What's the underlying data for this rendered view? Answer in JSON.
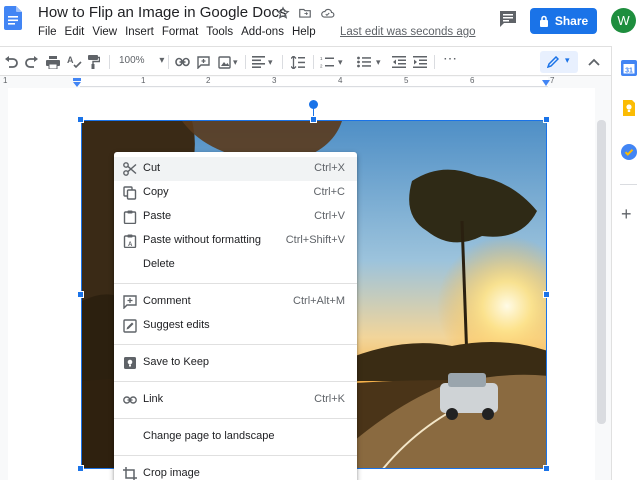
{
  "header": {
    "title": "How to Flip an Image in Google Docs",
    "menu": [
      "File",
      "Edit",
      "View",
      "Insert",
      "Format",
      "Tools",
      "Add-ons",
      "Help"
    ],
    "last_edit": "Last edit was seconds ago",
    "share_label": "Share",
    "avatar_letter": "W"
  },
  "toolbar": {
    "zoom": "100%"
  },
  "ruler": {
    "numbers": [
      "1",
      "1",
      "2",
      "3",
      "4",
      "5",
      "6",
      "7"
    ]
  },
  "context_menu": {
    "items": [
      {
        "label": "Cut",
        "shortcut": "Ctrl+X",
        "icon": "scissors-icon"
      },
      {
        "label": "Copy",
        "shortcut": "Ctrl+C",
        "icon": "copy-icon"
      },
      {
        "label": "Paste",
        "shortcut": "Ctrl+V",
        "icon": "paste-icon"
      },
      {
        "label": "Paste without formatting",
        "shortcut": "Ctrl+Shift+V",
        "icon": "paste-plain-icon"
      },
      {
        "label": "Delete",
        "shortcut": "",
        "icon": ""
      },
      {
        "label": "Comment",
        "shortcut": "Ctrl+Alt+M",
        "icon": "comment-icon"
      },
      {
        "label": "Suggest edits",
        "shortcut": "",
        "icon": "suggest-edits-icon"
      },
      {
        "label": "Save to Keep",
        "shortcut": "",
        "icon": "keep-icon"
      },
      {
        "label": "Link",
        "shortcut": "Ctrl+K",
        "icon": "link-icon"
      },
      {
        "label": "Change page to landscape",
        "shortcut": "",
        "icon": ""
      },
      {
        "label": "Crop image",
        "shortcut": "",
        "icon": "crop-icon"
      }
    ]
  },
  "colors": {
    "accent": "#1a73e8",
    "avatar": "#1e8e3e",
    "docs_blue": "#4285f4"
  }
}
